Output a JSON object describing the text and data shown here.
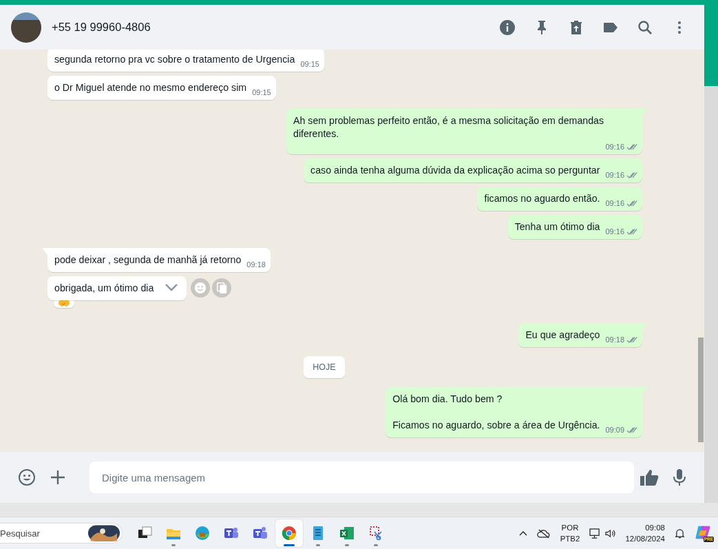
{
  "header": {
    "contact": "+55 19 99960-4806"
  },
  "messages": [
    {
      "kind": "incoming",
      "text": "segunda retorno pra vc sobre o tratamento de Urgencia",
      "time": "09:15",
      "tail": false,
      "hovered": false,
      "has_reaction": false
    },
    {
      "kind": "incoming",
      "text": "o Dr Miguel atende no mesmo endereço sim",
      "time": "09:15",
      "tail": false,
      "hovered": false,
      "has_reaction": false
    },
    {
      "kind": "outgoing",
      "text": "Ah sem problemas perfeito então, é a mesma solicitação em demandas diferentes.",
      "time": "09:16",
      "read": false,
      "tail": true,
      "hovered": false,
      "has_reaction": false
    },
    {
      "kind": "outgoing",
      "text": "caso ainda tenha alguma dúvida da explicação acima so perguntar",
      "time": "09:16",
      "read": false,
      "tail": false,
      "hovered": false,
      "has_reaction": false
    },
    {
      "kind": "outgoing",
      "text": "ficamos no aguardo então.",
      "time": "09:16",
      "read": false,
      "tail": false,
      "hovered": false,
      "has_reaction": false
    },
    {
      "kind": "outgoing",
      "text": "Tenha um ótimo dia",
      "time": "09:16",
      "read": false,
      "tail": false,
      "hovered": false,
      "has_reaction": false
    },
    {
      "kind": "incoming",
      "text": "pode deixar , segunda de manhã já retorno",
      "time": "09:18",
      "tail": true,
      "hovered": false,
      "has_reaction": false
    },
    {
      "kind": "incoming",
      "text": "obrigada, um ótimo dia",
      "tail": false,
      "hovered": true,
      "has_reaction": true
    },
    {
      "kind": "outgoing",
      "text": "Eu que agradeço",
      "time": "09:18",
      "read": false,
      "tail": true,
      "hovered": false,
      "has_reaction": false
    },
    {
      "kind": "date",
      "text": "HOJE"
    },
    {
      "kind": "outgoing",
      "text": "Olá bom dia. Tudo bem ?\n\nFicamos no aguardo, sobre a área de Urgência.",
      "time": "09:09",
      "read": false,
      "tail": true,
      "hovered": false,
      "has_reaction": false
    }
  ],
  "composer": {
    "placeholder": "Digite uma mensagem"
  },
  "taskbar": {
    "search_placeholder": "Pesquisar",
    "apps": [
      {
        "kind": "taskview",
        "running": false,
        "selected": false
      },
      {
        "kind": "explorer",
        "running": true,
        "selected": false
      },
      {
        "kind": "edge",
        "running": false,
        "selected": false
      },
      {
        "kind": "teams",
        "running": false,
        "selected": false
      },
      {
        "kind": "teams2",
        "running": false,
        "selected": false
      },
      {
        "kind": "chrome",
        "running": true,
        "selected": true
      },
      {
        "kind": "notepad",
        "running": true,
        "selected": false
      },
      {
        "kind": "excel",
        "running": true,
        "selected": false
      },
      {
        "kind": "snip",
        "running": true,
        "selected": false
      }
    ],
    "language": "POR",
    "layout": "PTB2",
    "time": "09:08",
    "date": "12/08/2024",
    "copilot_badge": "PRE"
  }
}
